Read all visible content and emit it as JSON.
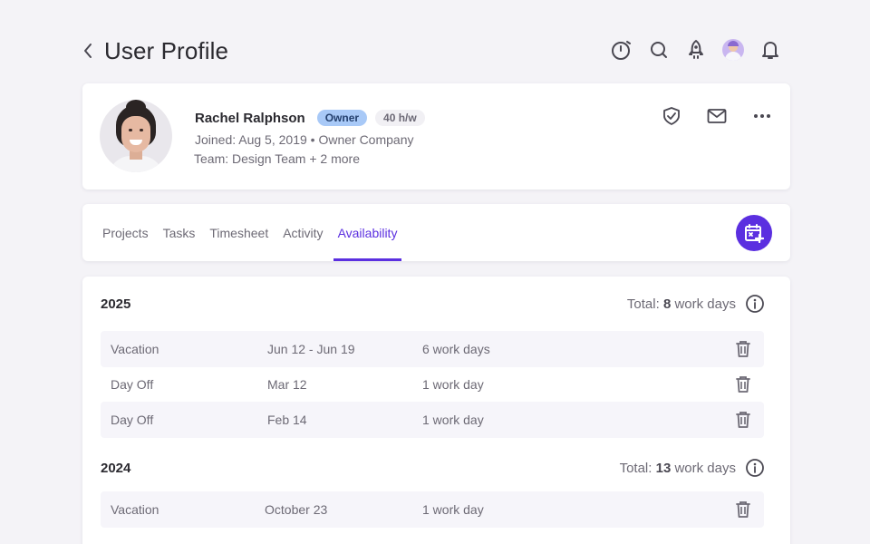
{
  "header": {
    "title": "User Profile",
    "icons": [
      "back-chevron-icon",
      "timer-icon",
      "search-icon",
      "rocket-icon",
      "user-avatar",
      "bell-icon"
    ]
  },
  "profile": {
    "name": "Rachel Ralphson",
    "role_badge": "Owner",
    "hours_badge": "40 h/w",
    "joined_line": "Joined: Aug 5, 2019 • Owner Company",
    "team_line": "Team: Design Team + 2 more",
    "actions": [
      "shield-check-icon",
      "mail-icon",
      "more-horizontal-icon"
    ]
  },
  "tabs": [
    {
      "label": "Projects",
      "active": false
    },
    {
      "label": "Tasks",
      "active": false
    },
    {
      "label": "Timesheet",
      "active": false
    },
    {
      "label": "Activity",
      "active": false
    },
    {
      "label": "Availability",
      "active": true
    }
  ],
  "colors": {
    "accent": "#5b2fe0",
    "owner_badge_bg": "#a8c9f7",
    "background": "#f4f3f7"
  },
  "availability": {
    "years": [
      {
        "year": "2025",
        "total_label": "Total:",
        "total_value": "8",
        "total_unit": "work days",
        "entries": [
          {
            "type": "Vacation",
            "dates": "Jun 12 - Jun 19",
            "duration": "6 work days"
          },
          {
            "type": "Day Off",
            "dates": "Mar 12",
            "duration": "1 work day"
          },
          {
            "type": "Day Off",
            "dates": "Feb 14",
            "duration": "1 work day"
          }
        ]
      },
      {
        "year": "2024",
        "total_label": "Total:",
        "total_value": "13",
        "total_unit": "work days",
        "entries": [
          {
            "type": "Vacation",
            "dates": "October 23",
            "duration": "1 work day"
          }
        ]
      }
    ]
  }
}
